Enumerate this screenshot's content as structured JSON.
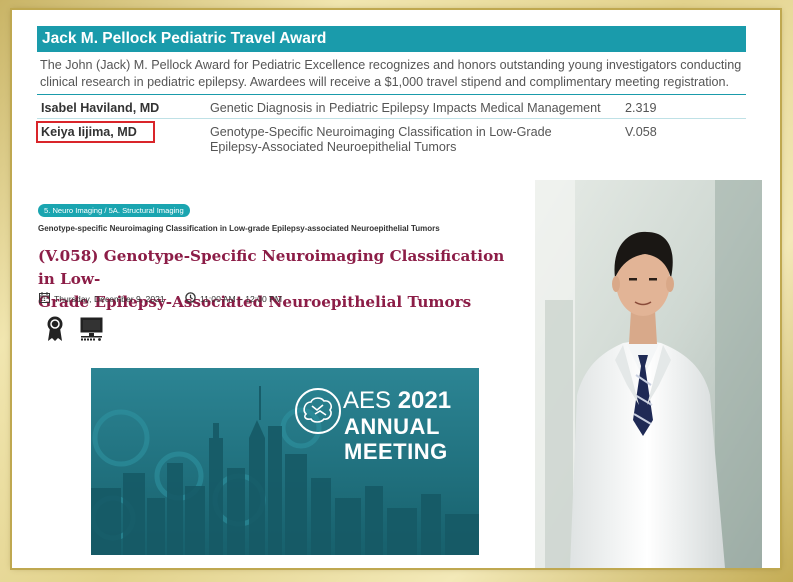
{
  "award": {
    "title": "Jack M. Pellock Pediatric Travel Award",
    "description_line1": "The John (Jack) M. Pellock Award for Pediatric Excellence recognizes and honors outstanding young investigators conducting",
    "description_line2": "clinical research in pediatric epilepsy. Awardees will receive a $1,000 travel stipend and complimentary meeting registration.",
    "rows": [
      {
        "name": "Isabel Haviland, MD",
        "title_line1": "Genetic Diagnosis in Pediatric Epilepsy Impacts Medical Management",
        "title_line2": "",
        "code": "2.319"
      },
      {
        "name": "Keiya Iijima, MD",
        "title_line1": "Genotype-Specific Neuroimaging Classification in Low-Grade",
        "title_line2": "Epilepsy-Associated Neuroepithelial Tumors",
        "code": "V.058"
      }
    ]
  },
  "abstract": {
    "category_tag": "5. Neuro Imaging / 5A. Structural Imaging",
    "short_title": "Genotype-specific Neuroimaging Classification in Low-grade Epilepsy-associated Neuroepithelial Tumors",
    "title_line1": "(V.058) Genotype-Specific Neuroimaging Classification in Low-",
    "title_line2": "Grade Epilepsy-Associated Neuroepithelial Tumors",
    "date": "Thursday, December 9, 2021",
    "time": "11:00 AM – 12:00 PM"
  },
  "banner": {
    "org": "AES",
    "year": "2021",
    "line2": "ANNUAL",
    "line3": "MEETING"
  },
  "icons": {
    "calendar": "calendar-icon",
    "clock": "clock-icon",
    "award": "award-ribbon-icon",
    "video": "monitor-icon",
    "brain": "brain-logo-icon"
  },
  "colors": {
    "teal": "#1a9bab",
    "title_maroon": "#8c1d47",
    "highlight_red": "#d9252a",
    "frame_gold": "#c9b466"
  }
}
